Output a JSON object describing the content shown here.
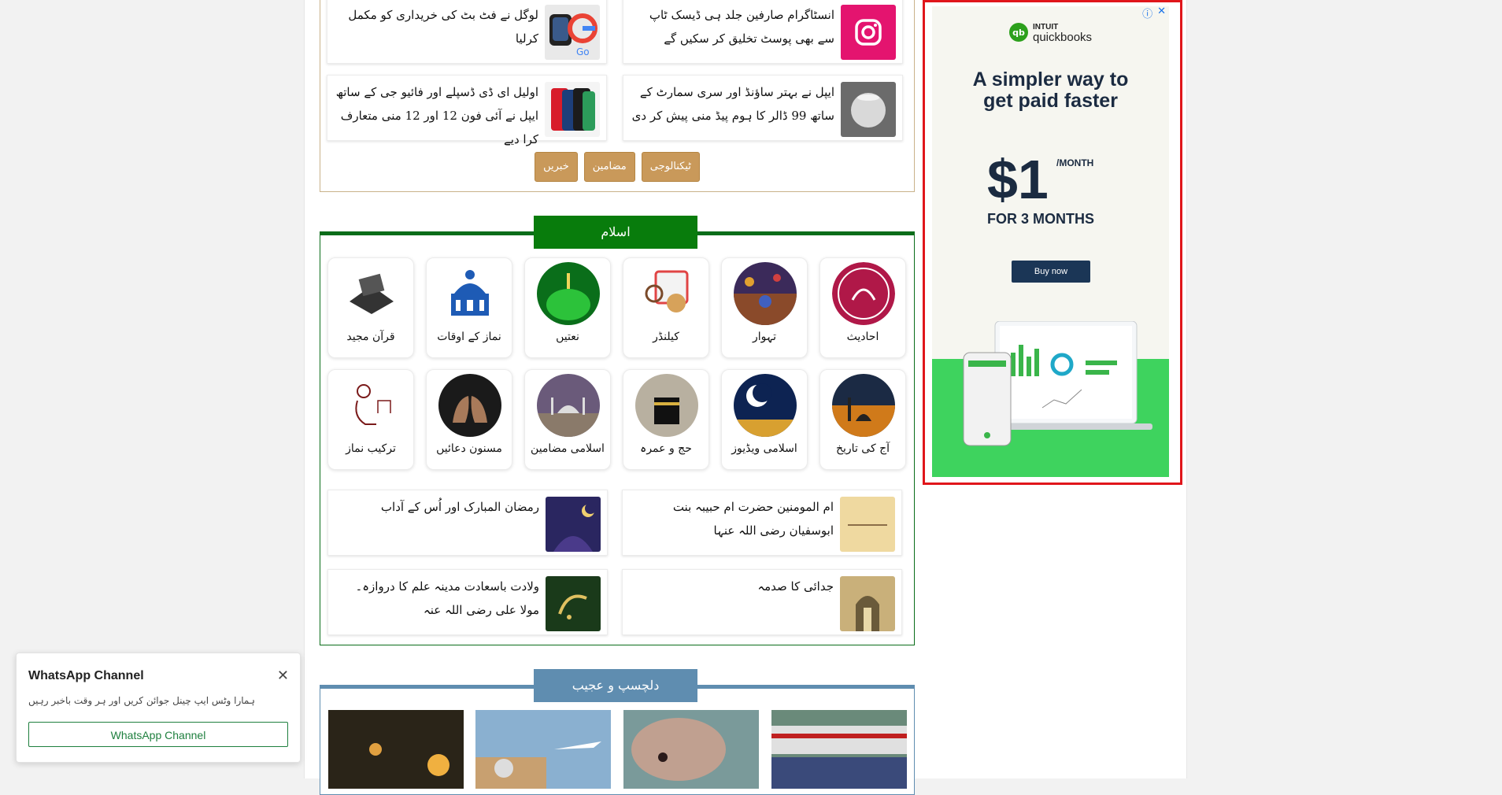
{
  "tech": {
    "cards": [
      {
        "title": "لوگل نے فٹ بٹ کی خریداری کو مکمل کرلیا",
        "thumb_icon": "smartwatch-google-icon"
      },
      {
        "title": "انسٹاگرام صارفین جلد ہی ڈیسک ٹاپ سے بھی پوسٹ تخلیق کر سکیں گے",
        "thumb_icon": "instagram-icon"
      },
      {
        "title": "اولیل ای ڈی ڈسپلے اور فائیو جی کے ساتھ ایپل نے آئی فون 12 اور 12 منی متعارف کرا دیے",
        "thumb_icon": "iphone-icon"
      },
      {
        "title": "ایپل نے بہتر ساؤنڈ اور سری سمارٹ کے ساتھ 99 ڈالر کا ہوم پیڈ منی پیش کر دی",
        "thumb_icon": "homepod-icon"
      }
    ],
    "tags": [
      "ٹیکنالوجی",
      "مضامین",
      "خبریں"
    ]
  },
  "islam": {
    "header": "اسلام",
    "tiles_row1": [
      "احادیث",
      "تہوار",
      "کیلنڈر",
      "نعتیں",
      "نماز کے اوقات",
      "قرآن مجید"
    ],
    "tiles_row2": [
      "آج کی تاریخ",
      "اسلامی ویڈیوز",
      "حج و عمرہ",
      "اسلامی مضامین",
      "مسنون دعائیں",
      "ترکیب نماز"
    ],
    "articles": [
      {
        "title": "ام المومنین حضرت ام حبیبہ بنت ابوسفیان رضی اللہ عنہا"
      },
      {
        "title": "رمضان المبارک اور اُس کے آداب"
      },
      {
        "title": "جدائی کا صدمہ"
      },
      {
        "title": "ولادت باسعادت مدینہ علم کا دروازہ۔ مولا علی رضی اللہ عنہ"
      }
    ]
  },
  "dilchasp": {
    "header": "دلچسپ و عجیب"
  },
  "ad": {
    "brand_small": "INTUIT",
    "brand_big": "quickbooks",
    "headline_1": "A simpler way to",
    "headline_2": "get paid faster",
    "price": "$1",
    "per_month": "/MONTH",
    "for_months": "FOR 3 MONTHS",
    "cta": "Buy now",
    "border_color": "#e0161b"
  },
  "whatsapp": {
    "title": "WhatsApp Channel",
    "subtitle": "ہمارا وٹس ایپ چینل جوائن کریں اور ہر وقت باخبر رہیں",
    "button": "WhatsApp Channel"
  },
  "colors": {
    "islam_green": "#087c0c",
    "dilchasp_blue": "#5f8db0",
    "tag_gold": "#c9995a"
  }
}
